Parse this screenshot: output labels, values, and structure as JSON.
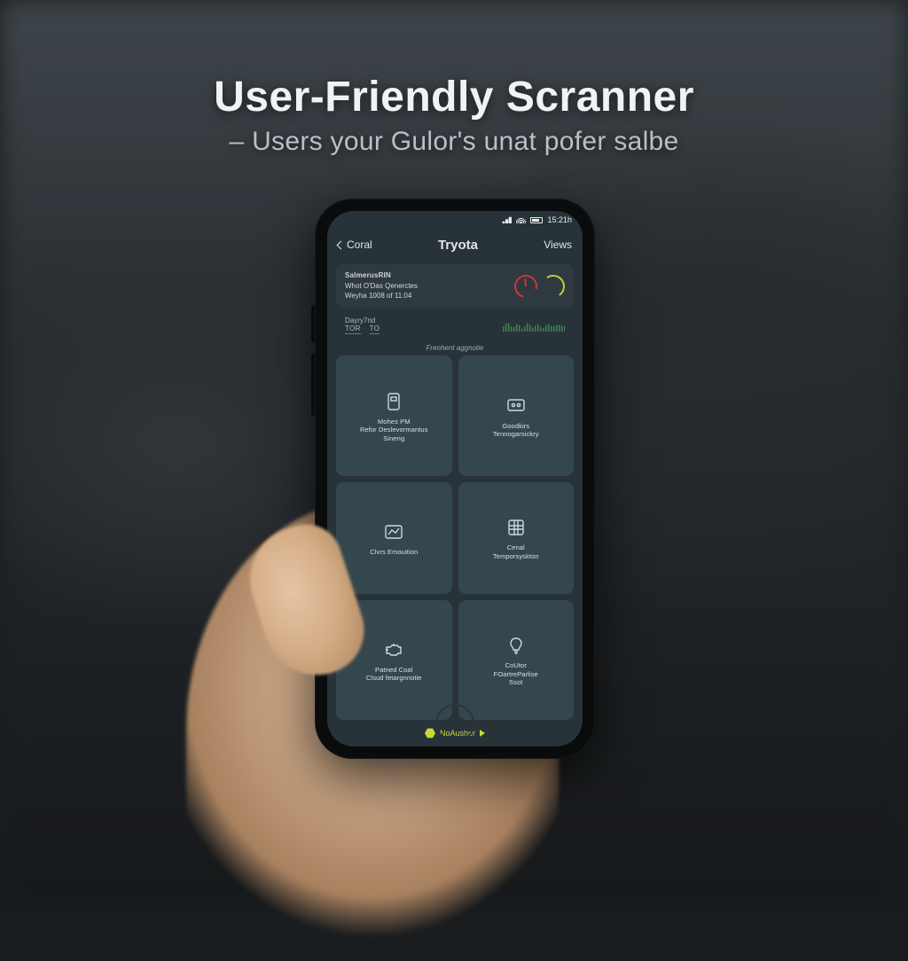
{
  "overlay": {
    "title": "User-Friendly Scranner",
    "subtitle": "– Users your Gulor's unat pofer salbe"
  },
  "statusbar": {
    "time": "15:21h"
  },
  "nav": {
    "back": "Coral",
    "title": "Tryota",
    "right": "Views"
  },
  "info": {
    "line1": "SalmerusRIN",
    "line2": "Whot O'Das Qenerctes",
    "line3": "Weyha 1008 of 11.04"
  },
  "row2": {
    "label": "Dayry7nd",
    "b1": "TOR",
    "b2": "TO"
  },
  "section_label": "Frenhent aggnotie",
  "grid": [
    {
      "label": "Mohes PM\nRefor Deslevormantus\nSineng"
    },
    {
      "label": "Goodkirs\nTennogarsickry"
    },
    {
      "label": "Clvrs Emouition"
    },
    {
      "label": "Cenal\nTemporsyskton"
    },
    {
      "label": "Patned Coal\nClsud fetargnnotie"
    },
    {
      "label": "CoUtor\nFOartreParlise\nSsot"
    }
  ],
  "footer": {
    "label": "NoAusher"
  }
}
